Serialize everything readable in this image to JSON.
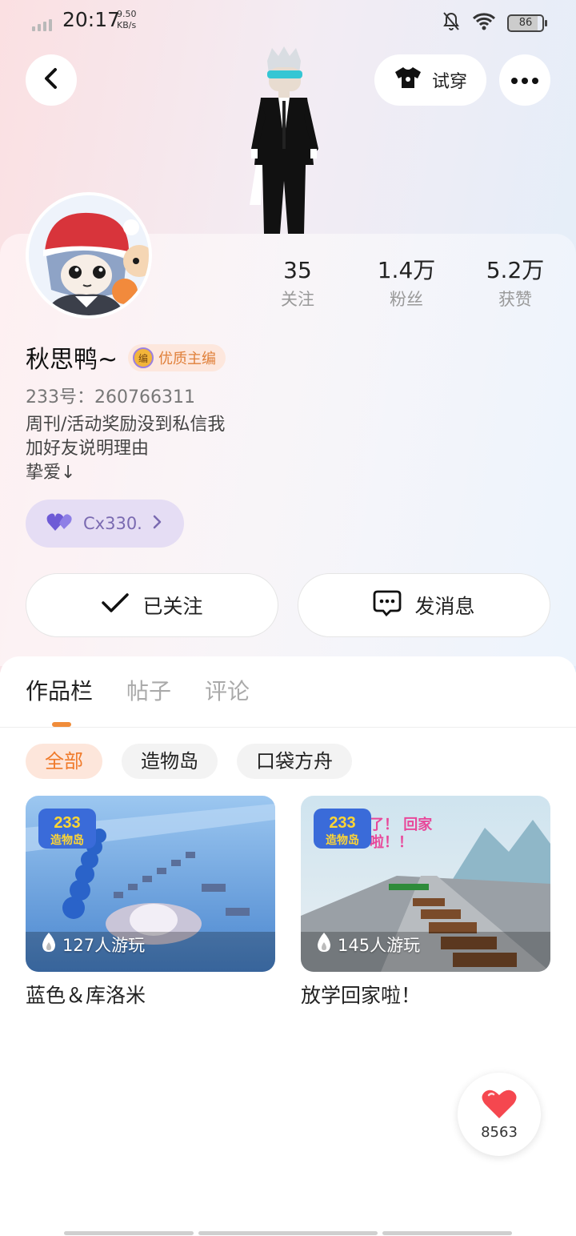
{
  "status": {
    "time": "20:17",
    "speed_value": "9.50",
    "speed_unit": "KB/s",
    "battery": "86"
  },
  "header": {
    "try_on_label": "试穿"
  },
  "profile": {
    "name": "秋思鸭~",
    "badge": "优质主编",
    "badge_glyph": "编",
    "uid": "233号：260766311",
    "bio": [
      "周刊/活动奖励没到私信我",
      "加好友说明理由",
      "挚爱↓"
    ],
    "cp_name": "Cx330.",
    "stats": [
      {
        "value": "35",
        "label": "关注"
      },
      {
        "value": "1.4万",
        "label": "粉丝"
      },
      {
        "value": "5.2万",
        "label": "获赞"
      }
    ],
    "follow_label": "已关注",
    "message_label": "发消息"
  },
  "tabs": [
    {
      "label": "作品栏"
    },
    {
      "label": "帖子"
    },
    {
      "label": "评论"
    }
  ],
  "filters": [
    {
      "label": "全部"
    },
    {
      "label": "造物岛"
    },
    {
      "label": "口袋方舟"
    }
  ],
  "games": [
    {
      "title": "蓝色＆库洛米",
      "plays": "127人游玩",
      "logo": "233",
      "logo_sub": "造物岛"
    },
    {
      "title": "放学回家啦！",
      "plays": "145人游玩",
      "logo": "233",
      "logo_sub": "造物岛",
      "overlay_text": [
        "了！ 回家",
        "啦！！"
      ]
    }
  ],
  "like_count": "8563",
  "colors": {
    "accent": "#f07a2a",
    "cp_purple": "#7a6ab1",
    "heart": "#f5474f"
  }
}
